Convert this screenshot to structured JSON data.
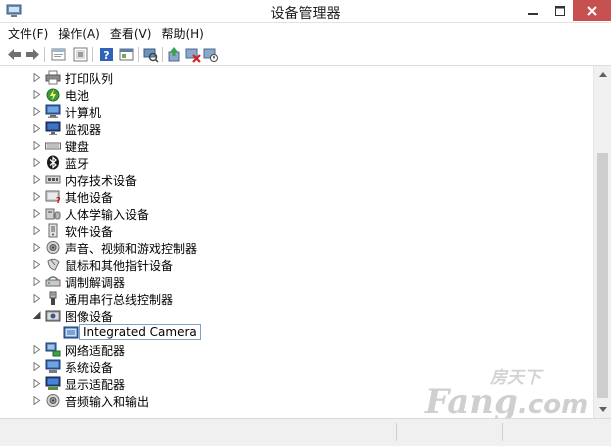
{
  "window": {
    "title": "设备管理器",
    "close_color": "#c75050"
  },
  "menu": [
    {
      "label": "文件(F)"
    },
    {
      "label": "操作(A)"
    },
    {
      "label": "查看(V)"
    },
    {
      "label": "帮助(H)"
    }
  ],
  "toolbar": [
    {
      "name": "back-icon"
    },
    {
      "name": "forward-icon"
    },
    {
      "name": "properties-icon"
    },
    {
      "name": "show-hidden-icon"
    },
    {
      "name": "help-icon"
    },
    {
      "name": "view-resources-icon"
    },
    {
      "name": "scan-hardware-icon"
    },
    {
      "name": "update-driver-icon"
    },
    {
      "name": "uninstall-icon"
    },
    {
      "name": "disable-device-icon"
    }
  ],
  "tree": [
    {
      "label": "打印队列",
      "icon": "printer-icon",
      "expanded": false
    },
    {
      "label": "电池",
      "icon": "battery-icon",
      "expanded": false
    },
    {
      "label": "计算机",
      "icon": "computer-icon",
      "expanded": false
    },
    {
      "label": "监视器",
      "icon": "monitor-icon",
      "expanded": false
    },
    {
      "label": "键盘",
      "icon": "keyboard-icon",
      "expanded": false
    },
    {
      "label": "蓝牙",
      "icon": "bluetooth-icon",
      "expanded": false
    },
    {
      "label": "内存技术设备",
      "icon": "memory-device-icon",
      "expanded": false
    },
    {
      "label": "其他设备",
      "icon": "other-devices-icon",
      "expanded": false
    },
    {
      "label": "人体学输入设备",
      "icon": "hid-icon",
      "expanded": false
    },
    {
      "label": "软件设备",
      "icon": "software-device-icon",
      "expanded": false
    },
    {
      "label": "声音、视频和游戏控制器",
      "icon": "sound-icon",
      "expanded": false
    },
    {
      "label": "鼠标和其他指针设备",
      "icon": "mouse-icon",
      "expanded": false
    },
    {
      "label": "调制解调器",
      "icon": "modem-icon",
      "expanded": false
    },
    {
      "label": "通用串行总线控制器",
      "icon": "usb-icon",
      "expanded": false
    },
    {
      "label": "图像设备",
      "icon": "imaging-device-icon",
      "expanded": true,
      "children": [
        {
          "label": "Integrated Camera",
          "icon": "camera-icon"
        }
      ]
    },
    {
      "label": "网络适配器",
      "icon": "network-adapter-icon",
      "expanded": false
    },
    {
      "label": "系统设备",
      "icon": "system-device-icon",
      "expanded": false
    },
    {
      "label": "显示适配器",
      "icon": "display-adapter-icon",
      "expanded": false
    },
    {
      "label": "音频输入和输出",
      "icon": "audio-io-icon",
      "expanded": false
    }
  ],
  "watermark": {
    "brand_cn": "房天下",
    "brand_en": "Fang.com"
  }
}
